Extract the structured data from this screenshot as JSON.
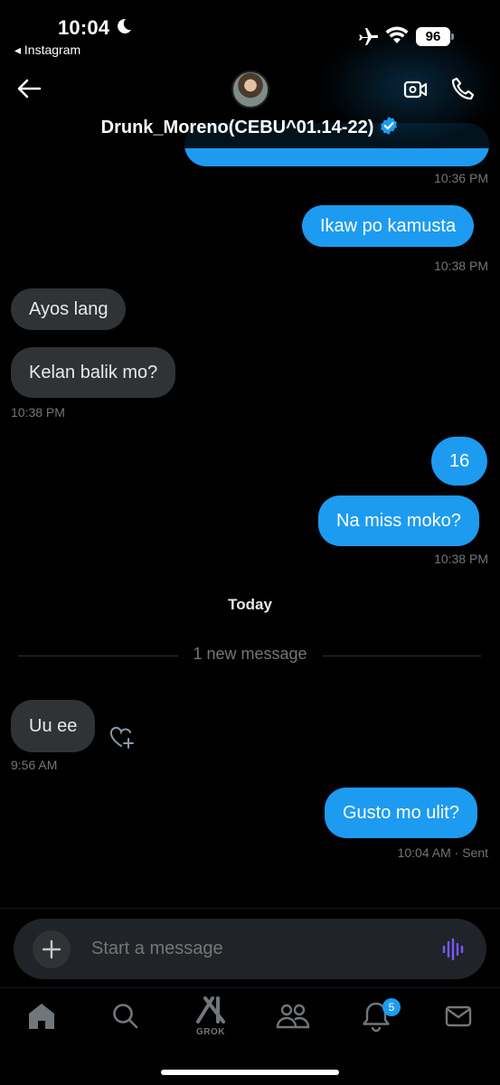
{
  "status_bar": {
    "time": "10:04",
    "back_app": "◂ Instagram",
    "battery": "96"
  },
  "header": {
    "contact_name": "Drunk_Moreno(CEBU^01.14-22)",
    "verified": true
  },
  "messages": [
    {
      "direction": "out",
      "text": "",
      "partial": true,
      "meta": "10:36 PM"
    },
    {
      "direction": "out",
      "text": "Ikaw po kamusta",
      "meta": "10:38 PM"
    },
    {
      "direction": "in",
      "text": "Ayos lang"
    },
    {
      "direction": "in",
      "text": "Kelan balik mo?",
      "meta": "10:38 PM"
    },
    {
      "direction": "out",
      "text": "16"
    },
    {
      "direction": "out",
      "text": "Na miss moko?",
      "meta": "10:38 PM"
    },
    {
      "direction": "in",
      "text": "Uu ee",
      "meta": "9:56 AM"
    },
    {
      "direction": "out",
      "text": "Gusto mo ulit?",
      "meta": "10:04 AM",
      "status": "· Sent"
    }
  ],
  "day_separator": "Today",
  "new_message_divider": "1 new message",
  "composer": {
    "placeholder": "Start a message"
  },
  "tabbar": {
    "items": [
      "home-icon",
      "search-icon",
      "grok-icon",
      "communities-icon",
      "notifications-icon",
      "messages-icon"
    ],
    "grok_label": "GROK",
    "notification_count": "5"
  },
  "colors": {
    "accent": "#1d9bf0",
    "incoming_bubble": "#2f3336",
    "background": "#000000",
    "muted_text": "#71767b",
    "voice_icon": "#7856ff"
  }
}
